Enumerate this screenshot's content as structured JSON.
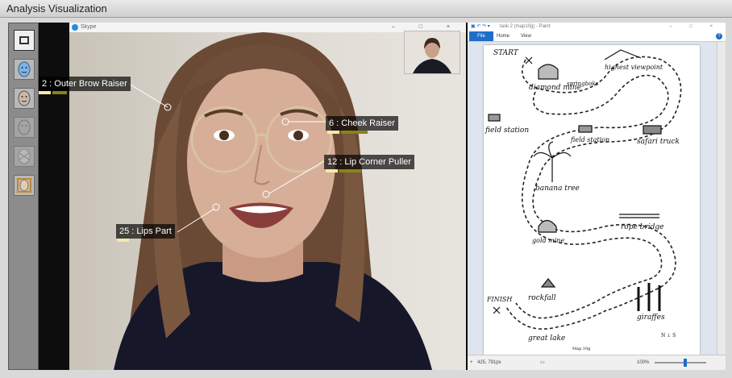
{
  "app": {
    "title": "Analysis Visualization"
  },
  "toolbar": {
    "tools": [
      {
        "icon": "frame-icon",
        "active": true
      },
      {
        "icon": "face-mesh-icon",
        "active": false
      },
      {
        "icon": "face-texture-icon",
        "active": false
      },
      {
        "icon": "face-outline-icon",
        "active": false
      },
      {
        "icon": "face-landmarks-icon",
        "active": false
      },
      {
        "icon": "face-crop-icon",
        "active": false
      }
    ]
  },
  "skype": {
    "title": "Skype",
    "controls": "–  □  ×"
  },
  "action_units": [
    {
      "label": "2 : Outer Brow Raiser",
      "intensity": 0.3
    },
    {
      "label": "6 : Cheek Raiser",
      "intensity": 0.55
    },
    {
      "label": "12 : Lip Corner Puller",
      "intensity": 0.45
    },
    {
      "label": "25 : Lips Part",
      "intensity": 0.2
    }
  ],
  "paint": {
    "title": "task 2 (map10g) - Paint",
    "controls": "–  □  ×",
    "tabs": {
      "file": "File",
      "home": "Home",
      "view": "View"
    },
    "help": "?",
    "status_coords": "425, 791px",
    "zoom": "100%",
    "zoom_fraction": 0.6,
    "map_labels": {
      "start": "START",
      "diamond_mine": "diamond mine",
      "springboks": "springboks",
      "highest_viewpoint": "highest viewpoint",
      "field_station_left": "field station",
      "field_station_mid": "field station",
      "safari_truck": "safari truck",
      "banana_tree": "banana tree",
      "gold_mine": "gold mine",
      "rope_bridge": "rope bridge",
      "finish": "FINISH",
      "rockfall": "rockfall",
      "giraffes": "giraffes",
      "great_lake": "great lake",
      "footer": "Map 10g",
      "north": "N ↓ S"
    }
  },
  "colors": {
    "accent": "#1e6ec7",
    "au_bar_light": "#f3e9a8",
    "au_bar_dark": "#8a8318",
    "au_label_bg": "#000000"
  }
}
